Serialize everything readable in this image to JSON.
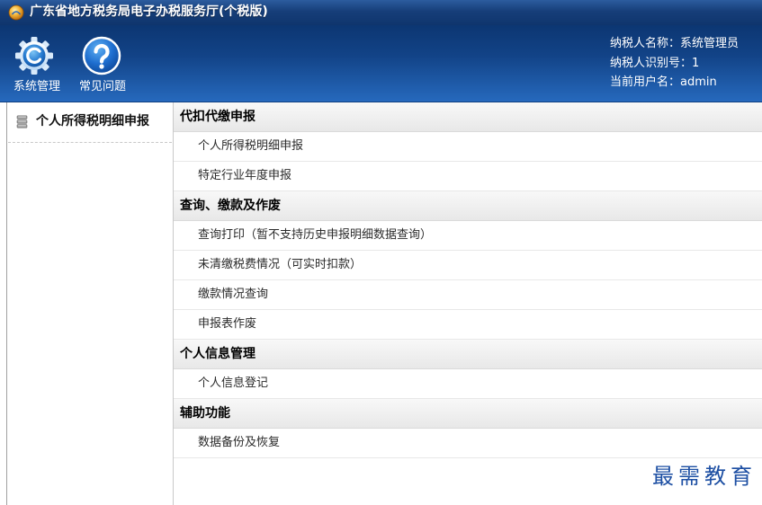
{
  "window": {
    "title": "广东省地方税务局电子办税服务厅(个税版)",
    "icon": "app-logo-icon"
  },
  "toolbar": {
    "buttons": [
      {
        "label": "系统管理",
        "icon": "gear-icon"
      },
      {
        "label": "常见问题",
        "icon": "question-icon"
      }
    ]
  },
  "user_info": {
    "taxpayer_name": {
      "label": "纳税人名称：",
      "value": "系统管理员"
    },
    "taxpayer_id": {
      "label": "纳税人识别号：",
      "value": "1"
    },
    "current_user": {
      "label": "当前用户名：",
      "value": "admin"
    }
  },
  "sidebar": {
    "items": [
      {
        "label": "个人所得税明细申报",
        "icon": "database-icon"
      }
    ]
  },
  "menu": {
    "sections": [
      {
        "title": "代扣代缴申报",
        "items": [
          "个人所得税明细申报",
          "特定行业年度申报"
        ]
      },
      {
        "title": "查询、缴款及作废",
        "items": [
          "查询打印（暂不支持历史申报明细数据查询）",
          "未清缴税费情况（可实时扣款）",
          "缴款情况查询",
          "申报表作废"
        ]
      },
      {
        "title": "个人信息管理",
        "items": [
          "个人信息登记"
        ]
      },
      {
        "title": "辅助功能",
        "items": [
          "数据备份及恢复"
        ]
      }
    ]
  },
  "watermark": {
    "text": "最需教育"
  },
  "colors": {
    "title_bar": "#163e79",
    "header_top": "#0c3672",
    "header_bottom": "#2669bd",
    "section_header_bg": "#e8e8e8",
    "watermark": "#1d4fa3"
  }
}
